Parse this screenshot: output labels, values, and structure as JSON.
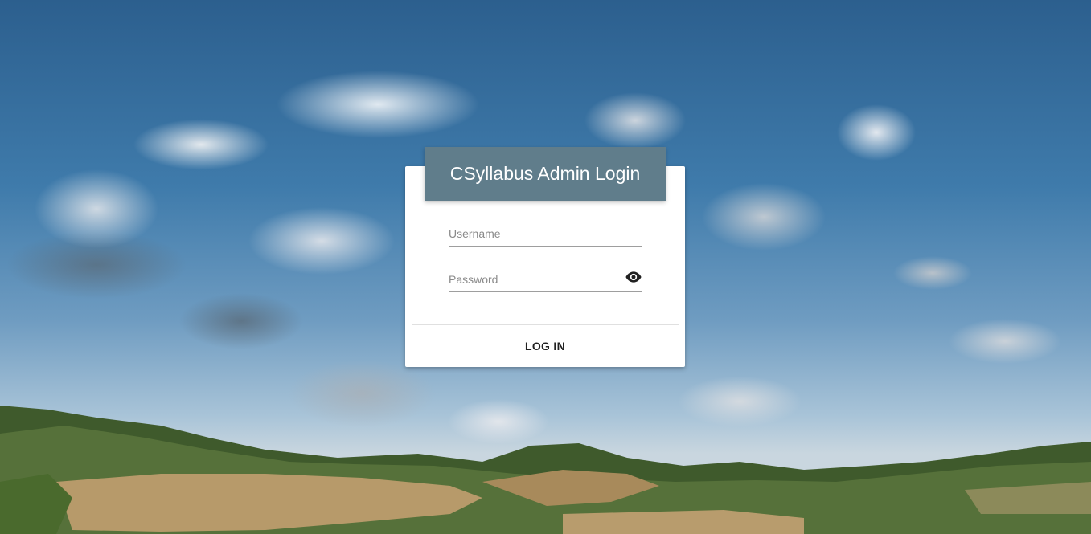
{
  "login": {
    "title": "CSyllabus Admin Login",
    "username_placeholder": "Username",
    "password_placeholder": "Password",
    "login_label": "LOG IN",
    "password_toggle_icon": "eye-icon"
  },
  "colors": {
    "header_bg": "#607d8b",
    "card_bg": "#ffffff"
  }
}
